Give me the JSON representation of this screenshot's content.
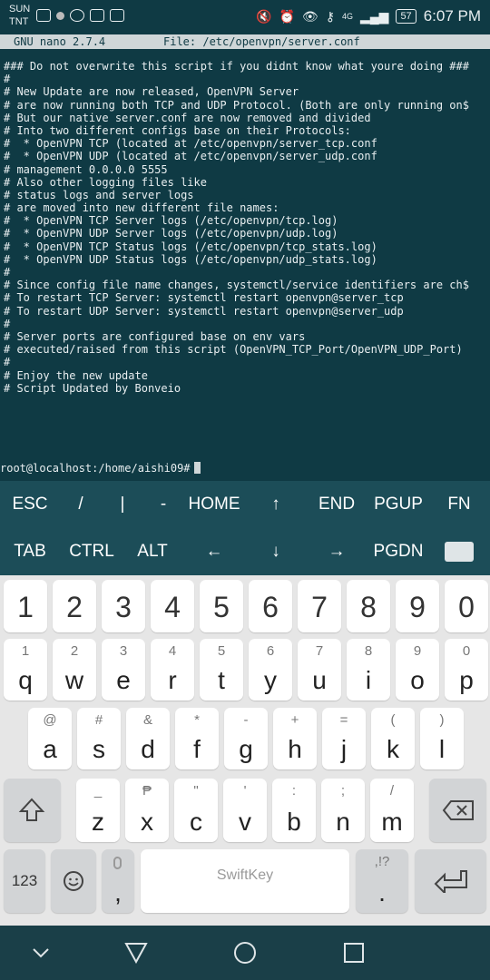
{
  "status_bar": {
    "day": "SUN",
    "carrier": "TNT",
    "network": "4G",
    "battery": "57",
    "time": "6:07 PM"
  },
  "nano": {
    "version": "GNU nano 2.7.4",
    "file": "File: /etc/openvpn/server.conf"
  },
  "file_lines": [
    "### Do not overwrite this script if you didnt know what youre doing ###",
    "#",
    "# New Update are now released, OpenVPN Server",
    "# are now running both TCP and UDP Protocol. (Both are only running on$",
    "# But our native server.conf are now removed and divided",
    "# Into two different configs base on their Protocols:",
    "#  * OpenVPN TCP (located at /etc/openvpn/server_tcp.conf",
    "#  * OpenVPN UDP (located at /etc/openvpn/server_udp.conf",
    "# management 0.0.0.0 5555",
    "# Also other logging files like",
    "# status logs and server logs",
    "# are moved into new different file names:",
    "#  * OpenVPN TCP Server logs (/etc/openvpn/tcp.log)",
    "#  * OpenVPN UDP Server logs (/etc/openvpn/udp.log)",
    "#  * OpenVPN TCP Status logs (/etc/openvpn/tcp_stats.log)",
    "#  * OpenVPN UDP Status logs (/etc/openvpn/udp_stats.log)",
    "#",
    "# Since config file name changes, systemctl/service identifiers are ch$",
    "# To restart TCP Server: systemctl restart openvpn@server_tcp",
    "# To restart UDP Server: systemctl restart openvpn@server_udp",
    "#",
    "# Server ports are configured base on env vars",
    "# executed/raised from this script (OpenVPN_TCP_Port/OpenVPN_UDP_Port)",
    "#",
    "# Enjoy the new update",
    "# Script Updated by Bonveio"
  ],
  "prompt": "root@localhost:/home/aishi09#",
  "extra_keys": {
    "row1": [
      "ESC",
      "/",
      "|",
      "-",
      "HOME",
      "↑",
      "END",
      "PGUP",
      "FN"
    ],
    "row2": [
      "TAB",
      "CTRL",
      "ALT",
      "←",
      "↓",
      "→",
      "PGDN"
    ]
  },
  "keyboard": {
    "numbers": [
      "1",
      "2",
      "3",
      "4",
      "5",
      "6",
      "7",
      "8",
      "9",
      "0"
    ],
    "row_q": [
      [
        "1",
        "q"
      ],
      [
        "2",
        "w"
      ],
      [
        "3",
        "e"
      ],
      [
        "4",
        "r"
      ],
      [
        "5",
        "t"
      ],
      [
        "6",
        "y"
      ],
      [
        "7",
        "u"
      ],
      [
        "8",
        "i"
      ],
      [
        "9",
        "o"
      ],
      [
        "0",
        "p"
      ]
    ],
    "row_a": [
      [
        "@",
        "a"
      ],
      [
        "#",
        "s"
      ],
      [
        "&",
        "d"
      ],
      [
        "*",
        "f"
      ],
      [
        "-",
        "g"
      ],
      [
        "+",
        "h"
      ],
      [
        "=",
        "j"
      ],
      [
        "(",
        "k"
      ],
      [
        ")",
        "l"
      ]
    ],
    "row_z": [
      [
        "_",
        "z"
      ],
      [
        "₱",
        "x"
      ],
      [
        "\"",
        "c"
      ],
      [
        "'",
        "v"
      ],
      [
        ":",
        "b"
      ],
      [
        ";",
        "n"
      ],
      [
        "/",
        "m"
      ]
    ],
    "symbols_key": "123",
    "comma": ",",
    "period": ".",
    "period_sup": ",!?",
    "space_label": "SwiftKey"
  }
}
